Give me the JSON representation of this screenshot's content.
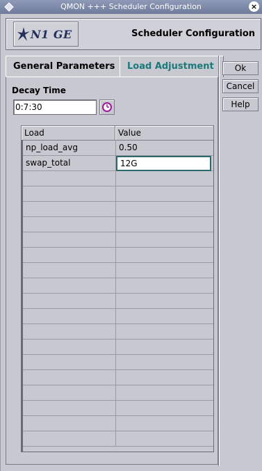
{
  "window": {
    "title": "QMON +++ Scheduler Configuration"
  },
  "header": {
    "logo_text": "N1 GE",
    "heading": "Scheduler Configuration"
  },
  "tabs": [
    {
      "label": "General Parameters",
      "active": false
    },
    {
      "label": "Load Adjustment",
      "active": true
    }
  ],
  "decay": {
    "label": "Decay Time",
    "value": "0:7:30"
  },
  "table": {
    "columns": [
      "Load",
      "Value"
    ],
    "rows": [
      {
        "load": "np_load_avg",
        "value": "0.50"
      },
      {
        "load": "swap_total",
        "value": "12G"
      }
    ]
  },
  "buttons": {
    "ok": "Ok",
    "cancel": "Cancel",
    "help": "Help"
  },
  "colors": {
    "active_tab": "#1a7a7a",
    "titlebar": "#7a86a4"
  }
}
